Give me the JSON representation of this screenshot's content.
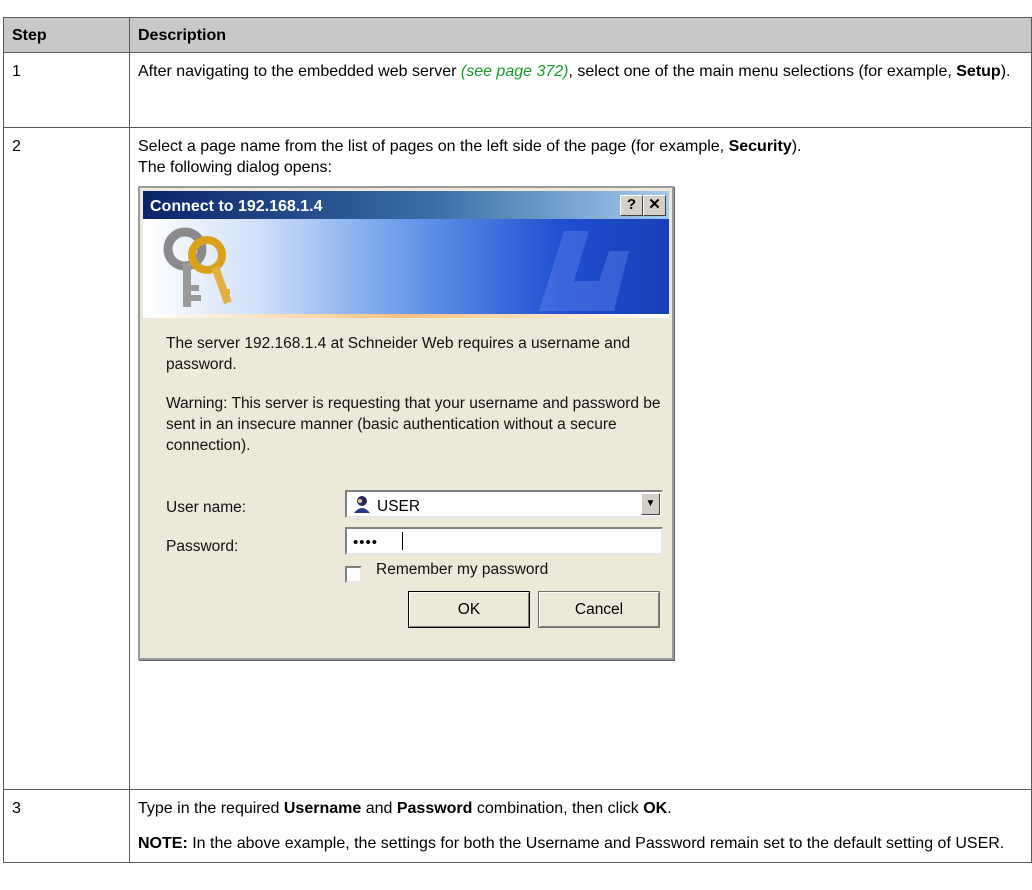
{
  "table": {
    "headers": {
      "step": "Step",
      "description": "Description"
    },
    "rows": [
      {
        "step": "1",
        "text_a": "After navigating to the embedded web server ",
        "link": "(see page 372)",
        "text_b": ", select one of the main menu selections (for example, ",
        "bold": "Setup",
        "text_c": ")."
      },
      {
        "step": "2",
        "text_a": "Select a page name from the list of pages on the left side of the page (for example, ",
        "bold": "Security",
        "text_b": ").",
        "text_c": "The following dialog opens:"
      },
      {
        "step": "3",
        "text_a": "Type in the required ",
        "bold_a": "Username",
        "text_b": " and ",
        "bold_b": "Password",
        "text_c": " combination, then click ",
        "bold_c": "OK",
        "text_d": ".",
        "note_label": "NOTE:",
        "note_text": " In the above example, the settings for both the Username and Password remain set to the default setting of USER."
      }
    ]
  },
  "dialog": {
    "title": "Connect to 192.168.1.4",
    "help_button": "?",
    "close_button": "✕",
    "message": "The server 192.168.1.4 at Schneider Web requires a username and password.",
    "warning": "Warning: This server is requesting that your username and password be sent in an insecure manner (basic authentication without a secure connection).",
    "username_label": "User name:",
    "username_value": "USER",
    "password_label": "Password:",
    "password_value": "••••",
    "remember_label": "Remember my password",
    "ok_label": "OK",
    "cancel_label": "Cancel"
  }
}
